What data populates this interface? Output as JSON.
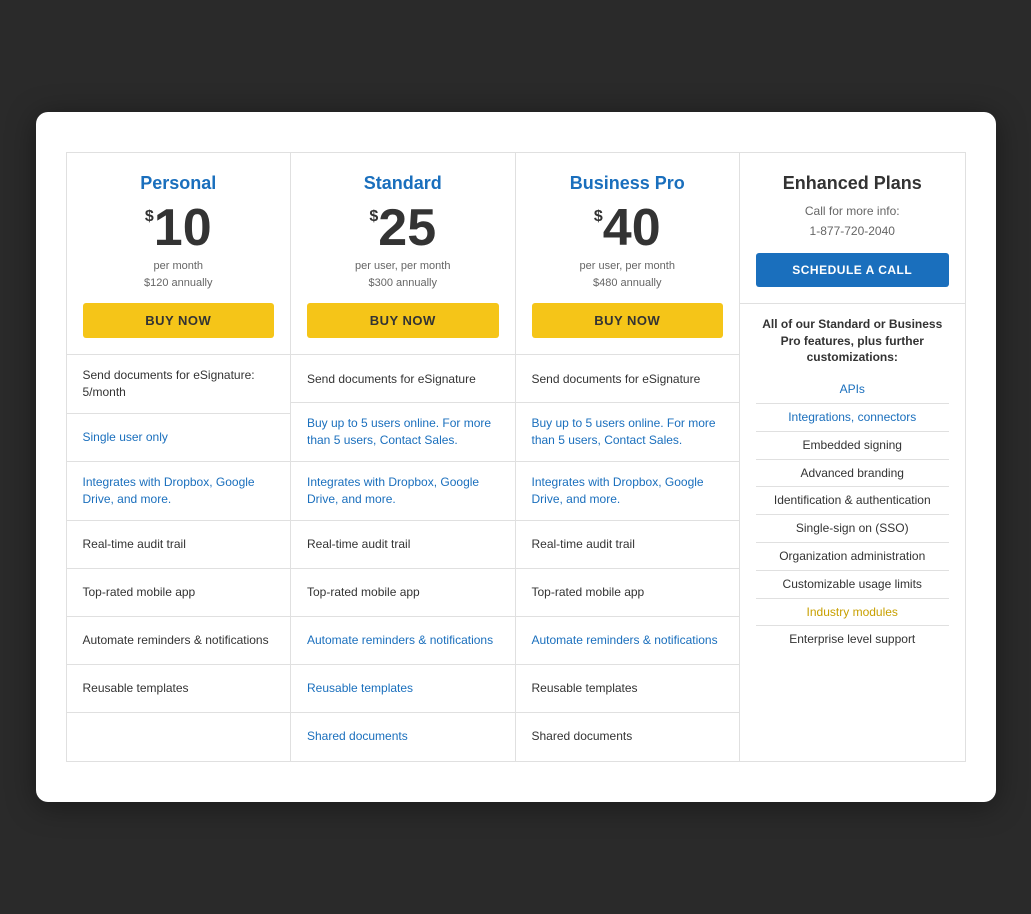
{
  "plans": [
    {
      "id": "personal",
      "name": "Personal",
      "name_color": "blue",
      "price_symbol": "$",
      "price_amount": "10",
      "price_line1": "per month",
      "price_line2": "$120 annually",
      "button_label": "BUY NOW",
      "button_type": "buy",
      "features": [
        {
          "text": "Send documents for eSignature: 5/month",
          "style": "dark"
        },
        {
          "text": "Single user only",
          "style": "blue"
        },
        {
          "text": "Integrates with Dropbox, Google Drive, and more.",
          "style": "blue"
        },
        {
          "text": "Real-time audit trail",
          "style": "dark"
        },
        {
          "text": "Top-rated mobile app",
          "style": "dark"
        },
        {
          "text": "Automate reminders & notifications",
          "style": "dark"
        },
        {
          "text": "Reusable templates",
          "style": "dark"
        },
        {
          "text": "",
          "style": "empty"
        }
      ]
    },
    {
      "id": "standard",
      "name": "Standard",
      "name_color": "blue",
      "price_symbol": "$",
      "price_amount": "25",
      "price_line1": "per user, per month",
      "price_line2": "$300 annually",
      "button_label": "BUY NOW",
      "button_type": "buy",
      "features": [
        {
          "text": "Send documents for eSignature",
          "style": "dark"
        },
        {
          "text": "Buy up to 5 users online. For more than 5 users, Contact Sales.",
          "style": "blue"
        },
        {
          "text": "Integrates with Dropbox, Google Drive, and more.",
          "style": "blue"
        },
        {
          "text": "Real-time audit trail",
          "style": "dark"
        },
        {
          "text": "Top-rated mobile app",
          "style": "dark"
        },
        {
          "text": "Automate reminders & notifications",
          "style": "blue"
        },
        {
          "text": "Reusable templates",
          "style": "blue"
        },
        {
          "text": "Shared documents",
          "style": "blue"
        }
      ]
    },
    {
      "id": "business-pro",
      "name": "Business Pro",
      "name_color": "blue",
      "price_symbol": "$",
      "price_amount": "40",
      "price_line1": "per user, per month",
      "price_line2": "$480 annually",
      "button_label": "BUY NOW",
      "button_type": "buy",
      "features": [
        {
          "text": "Send documents for eSignature",
          "style": "dark"
        },
        {
          "text": "Buy up to 5 users online. For more than 5 users, Contact Sales.",
          "style": "blue"
        },
        {
          "text": "Integrates with Dropbox, Google Drive, and more.",
          "style": "blue"
        },
        {
          "text": "Real-time audit trail",
          "style": "dark"
        },
        {
          "text": "Top-rated mobile app",
          "style": "dark"
        },
        {
          "text": "Automate reminders & notifications",
          "style": "blue"
        },
        {
          "text": "Reusable templates",
          "style": "dark"
        },
        {
          "text": "Shared documents",
          "style": "dark"
        }
      ]
    },
    {
      "id": "enhanced",
      "name": "Enhanced Plans",
      "name_color": "dark",
      "call_line1": "Call for more info:",
      "call_line2": "1-877-720-2040",
      "button_label": "SCHEDULE A CALL",
      "button_type": "schedule",
      "enhanced_intro": "All of our Standard or Business Pro features, plus further customizations:",
      "enhanced_items": [
        {
          "text": "APIs",
          "style": "blue"
        },
        {
          "text": "Integrations, connectors",
          "style": "blue"
        },
        {
          "text": "Embedded signing",
          "style": "dark"
        },
        {
          "text": "Advanced branding",
          "style": "dark"
        },
        {
          "text": "Identification & authentication",
          "style": "dark"
        },
        {
          "text": "Single-sign on (SSO)",
          "style": "dark"
        },
        {
          "text": "Organization administration",
          "style": "dark"
        },
        {
          "text": "Customizable usage limits",
          "style": "dark"
        },
        {
          "text": "Industry modules",
          "style": "gold"
        },
        {
          "text": "Enterprise level support",
          "style": "dark"
        }
      ]
    }
  ]
}
